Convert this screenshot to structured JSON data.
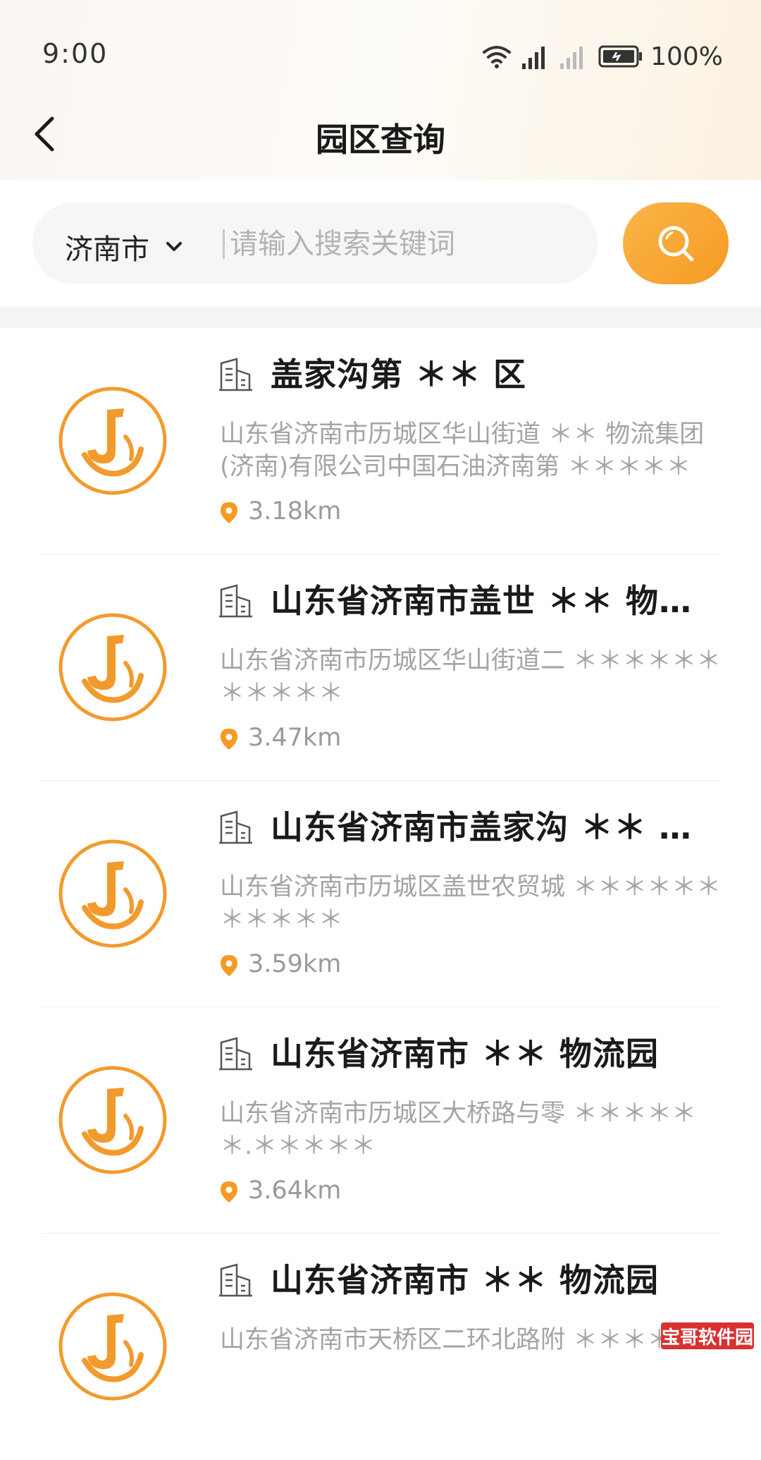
{
  "status_bar": {
    "time": "9:00",
    "battery": "100%"
  },
  "header": {
    "title": "园区查询"
  },
  "search": {
    "city": "济南市",
    "placeholder": "请输入搜索关键词"
  },
  "colors": {
    "accent": "#F59A23",
    "title": "#1A1A1A",
    "subtext": "#A4A4A4"
  },
  "parks": [
    {
      "name": "盖家沟第 ＊＊ 区",
      "address": "山东省济南市历城区华山街道 ＊＊ 物流集团(济南)有限公司中国石油济南第 ＊＊＊＊＊",
      "distance": "3.18km"
    },
    {
      "name": "山东省济南市盖世 ＊＊ 物流…",
      "address": "山东省济南市历城区华山街道二 ＊＊＊＊＊＊＊＊＊＊＊",
      "distance": "3.47km"
    },
    {
      "name": "山东省济南市盖家沟 ＊＊ 市场",
      "address": "山东省济南市历城区盖世农贸城 ＊＊＊＊＊＊＊＊＊＊＊",
      "distance": "3.59km"
    },
    {
      "name": "山东省济南市 ＊＊ 物流园",
      "address": "山东省济南市历城区大桥路与零 ＊＊＊＊＊＊.＊＊＊＊＊",
      "distance": "3.64km"
    },
    {
      "name": "山东省济南市 ＊＊ 物流园",
      "address": "山东省济南市天桥区二环北路附 ＊＊＊＊＊",
      "distance": ""
    }
  ],
  "watermark": "宝哥软件园"
}
